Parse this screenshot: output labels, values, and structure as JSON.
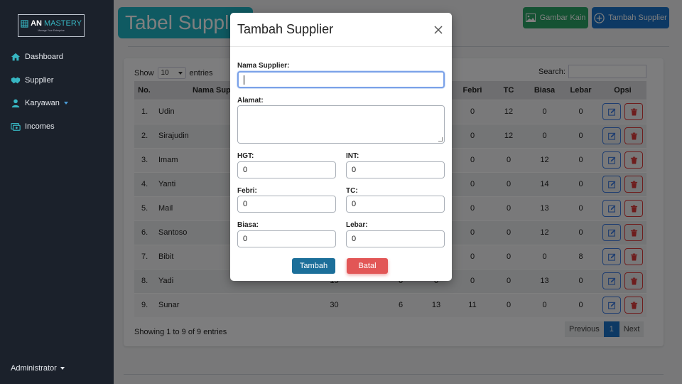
{
  "brand": {
    "part1": "AN",
    "part2": "MASTERY",
    "subtitle": "Manage Your Enterprise"
  },
  "sidebar": {
    "items": [
      {
        "label": "Dashboard",
        "icon": "home-icon"
      },
      {
        "label": "Supplier",
        "icon": "handshake-icon"
      },
      {
        "label": "Karyawan",
        "icon": "user-icon"
      },
      {
        "label": "Incomes",
        "icon": "money-icon"
      }
    ],
    "user": "Administrator"
  },
  "header": {
    "title": "Tabel Supplier",
    "btn_kain": "Gambar Kain",
    "btn_supplier": "Tambah Supplier"
  },
  "table_controls": {
    "show": "Show",
    "entries_value": "10",
    "entries": "entries",
    "search": "Search:"
  },
  "table": {
    "columns": [
      "No.",
      "Nama Supplier",
      "",
      "",
      "",
      "Febri",
      "TC",
      "Biasa",
      "Lebar",
      "Opsi"
    ],
    "rows": [
      [
        "1.",
        "Udin",
        "",
        "",
        "",
        "0",
        "12",
        "0",
        "0"
      ],
      [
        "2.",
        "Sirajudin",
        "",
        "",
        "",
        "0",
        "12",
        "0",
        "0"
      ],
      [
        "3.",
        "Imam",
        "",
        "",
        "",
        "0",
        "0",
        "12",
        "0"
      ],
      [
        "4.",
        "Yanti",
        "",
        "",
        "",
        "0",
        "0",
        "14",
        "0"
      ],
      [
        "5.",
        "Mail",
        "",
        "",
        "",
        "0",
        "0",
        "13",
        "0"
      ],
      [
        "6.",
        "Santoso",
        "",
        "",
        "",
        "0",
        "0",
        "12",
        "0"
      ],
      [
        "7.",
        "Bibit",
        "",
        "",
        "",
        "0",
        "0",
        "0",
        "8"
      ],
      [
        "8.",
        "Yadi",
        "15",
        "0",
        "0",
        "0",
        "0",
        "13",
        "0"
      ],
      [
        "9.",
        "Sunar",
        "30",
        "6",
        "13",
        "11",
        "0",
        "0",
        "0"
      ]
    ]
  },
  "footer": {
    "info": "Showing 1 to 9 of 9 entries",
    "prev": "Previous",
    "page": "1",
    "next": "Next"
  },
  "modal": {
    "title": "Tambah Supplier",
    "nama_label": "Nama Supplier:",
    "nama_value": "",
    "alamat_label": "Alamat:",
    "hgt_label": "HGT:",
    "hgt_value": "0",
    "int_label": "INT:",
    "int_value": "0",
    "febri_label": "Febri:",
    "febri_value": "0",
    "tc_label": "TC:",
    "tc_value": "0",
    "biasa_label": "Biasa:",
    "biasa_value": "0",
    "lebar_label": "Lebar:",
    "lebar_value": "0",
    "submit": "Tambah",
    "cancel": "Batal"
  },
  "colors": {
    "sidebar": "#1b212b",
    "title_pill": "#1fb4c4",
    "btn_kain": "#2ba566",
    "btn_supplier": "#1a73c8",
    "btn_tambah": "#1c6f9a",
    "btn_batal": "#e25656"
  }
}
